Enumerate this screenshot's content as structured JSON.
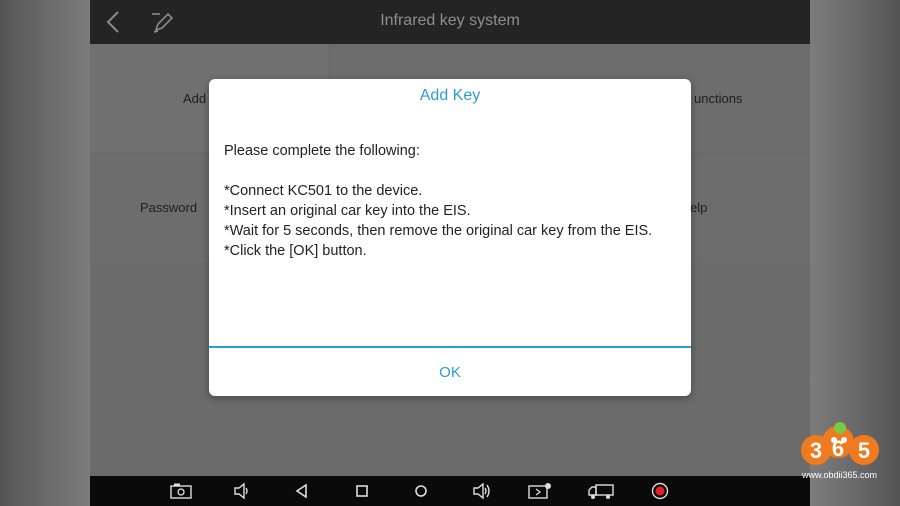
{
  "topbar": {
    "title": "Infrared key system",
    "back_icon": "back-arrow-icon",
    "edit_icon": "pencil-icon"
  },
  "menu": {
    "add_partial": "Add",
    "functions_partial": "unctions",
    "password_partial": "Password",
    "help_partial": "elp"
  },
  "dialog": {
    "title": "Add Key",
    "intro": "Please complete the following:",
    "steps": [
      "*Connect KC501 to the device.",
      "*Insert an original car key into the EIS.",
      "*Wait for 5 seconds, then remove the original car key from the EIS.",
      "*Click the [OK] button."
    ],
    "ok_label": "OK"
  },
  "navbar": {
    "icons": [
      "screenshot-icon",
      "volume-down-icon",
      "nav-back-icon",
      "nav-home-icon",
      "nav-circle-icon",
      "volume-up-icon",
      "vci-bluetooth-icon",
      "truck-icon",
      "record-icon"
    ]
  },
  "watermark": {
    "digits": [
      "3",
      "6",
      "5"
    ],
    "url": "www.obdii365.com"
  },
  "colors": {
    "accent": "#2f9bd0",
    "record": "#e0202a",
    "logo_orange": "#f07a20"
  }
}
